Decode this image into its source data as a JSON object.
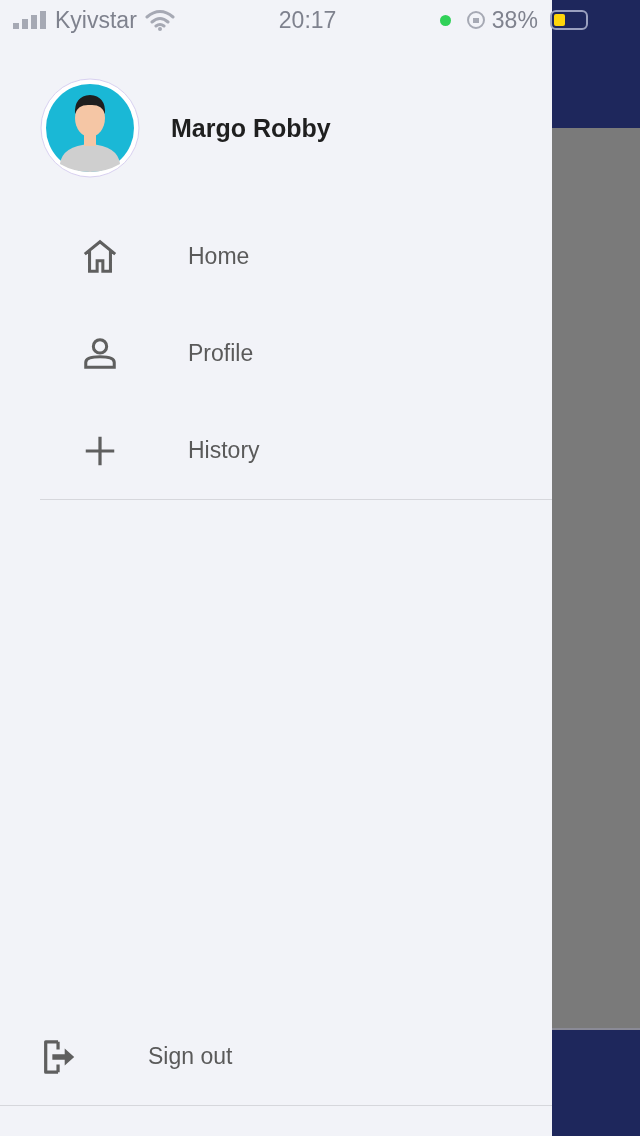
{
  "status_bar": {
    "carrier": "Kyivstar",
    "time": "20:17",
    "battery": "38%"
  },
  "drawer": {
    "user": {
      "name": "Margo Robby"
    },
    "items": [
      {
        "kind": "home",
        "label": "Home"
      },
      {
        "kind": "profile",
        "label": "Profile"
      },
      {
        "kind": "history",
        "label": "History"
      }
    ],
    "footer": {
      "kind": "signout",
      "label": "Sign out"
    }
  }
}
